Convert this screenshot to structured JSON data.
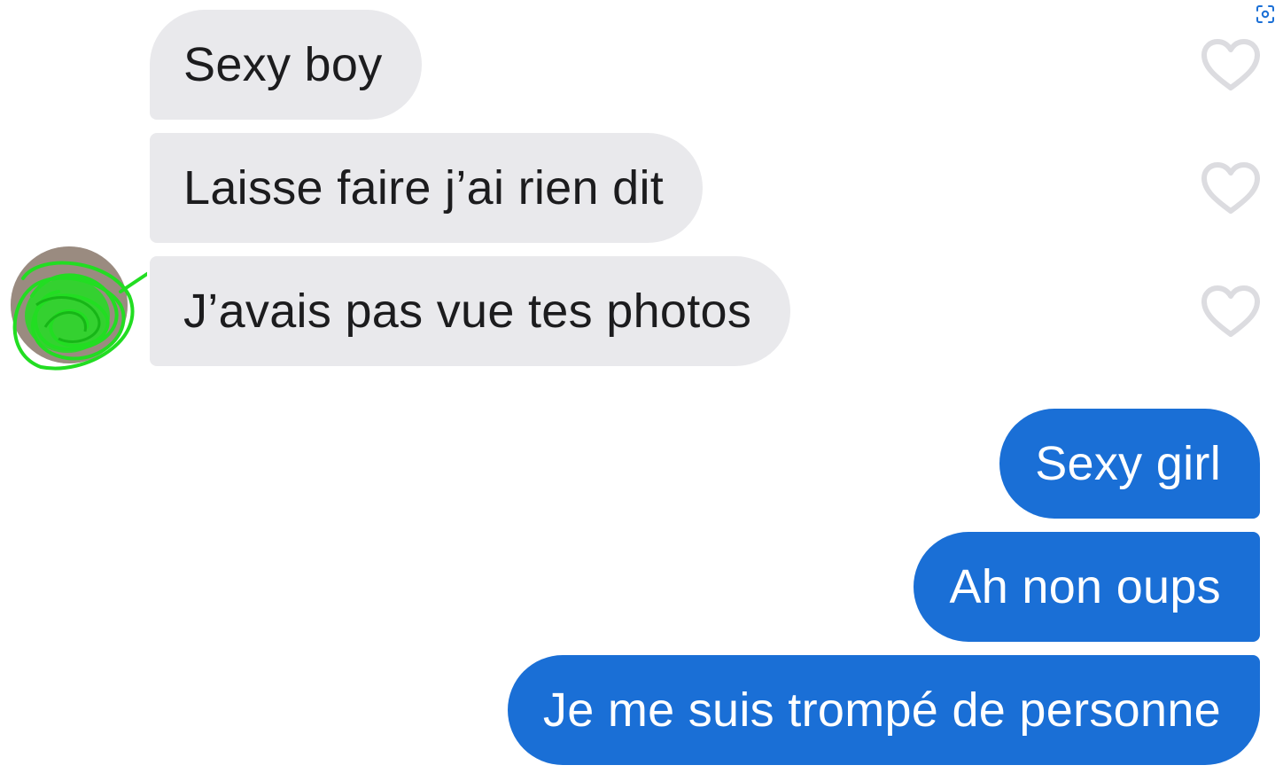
{
  "conversation": {
    "incoming": [
      {
        "text": "Sexy boy"
      },
      {
        "text": "Laisse faire j’ai rien dit"
      },
      {
        "text": "J’avais pas vue tes photos"
      }
    ],
    "outgoing": [
      {
        "text": "Sexy girl"
      },
      {
        "text": "Ah non oups"
      },
      {
        "text": "Je me suis trompé de personne"
      }
    ]
  },
  "colors": {
    "incoming_bubble": "#e9e9ec",
    "outgoing_bubble": "#1a6fd6",
    "heart_outline": "#dcdce0",
    "scribble": "#22dd22"
  },
  "icons": {
    "like": "heart-outline-icon",
    "avatar": "scribbled-avatar",
    "corner": "visual-search-icon"
  }
}
